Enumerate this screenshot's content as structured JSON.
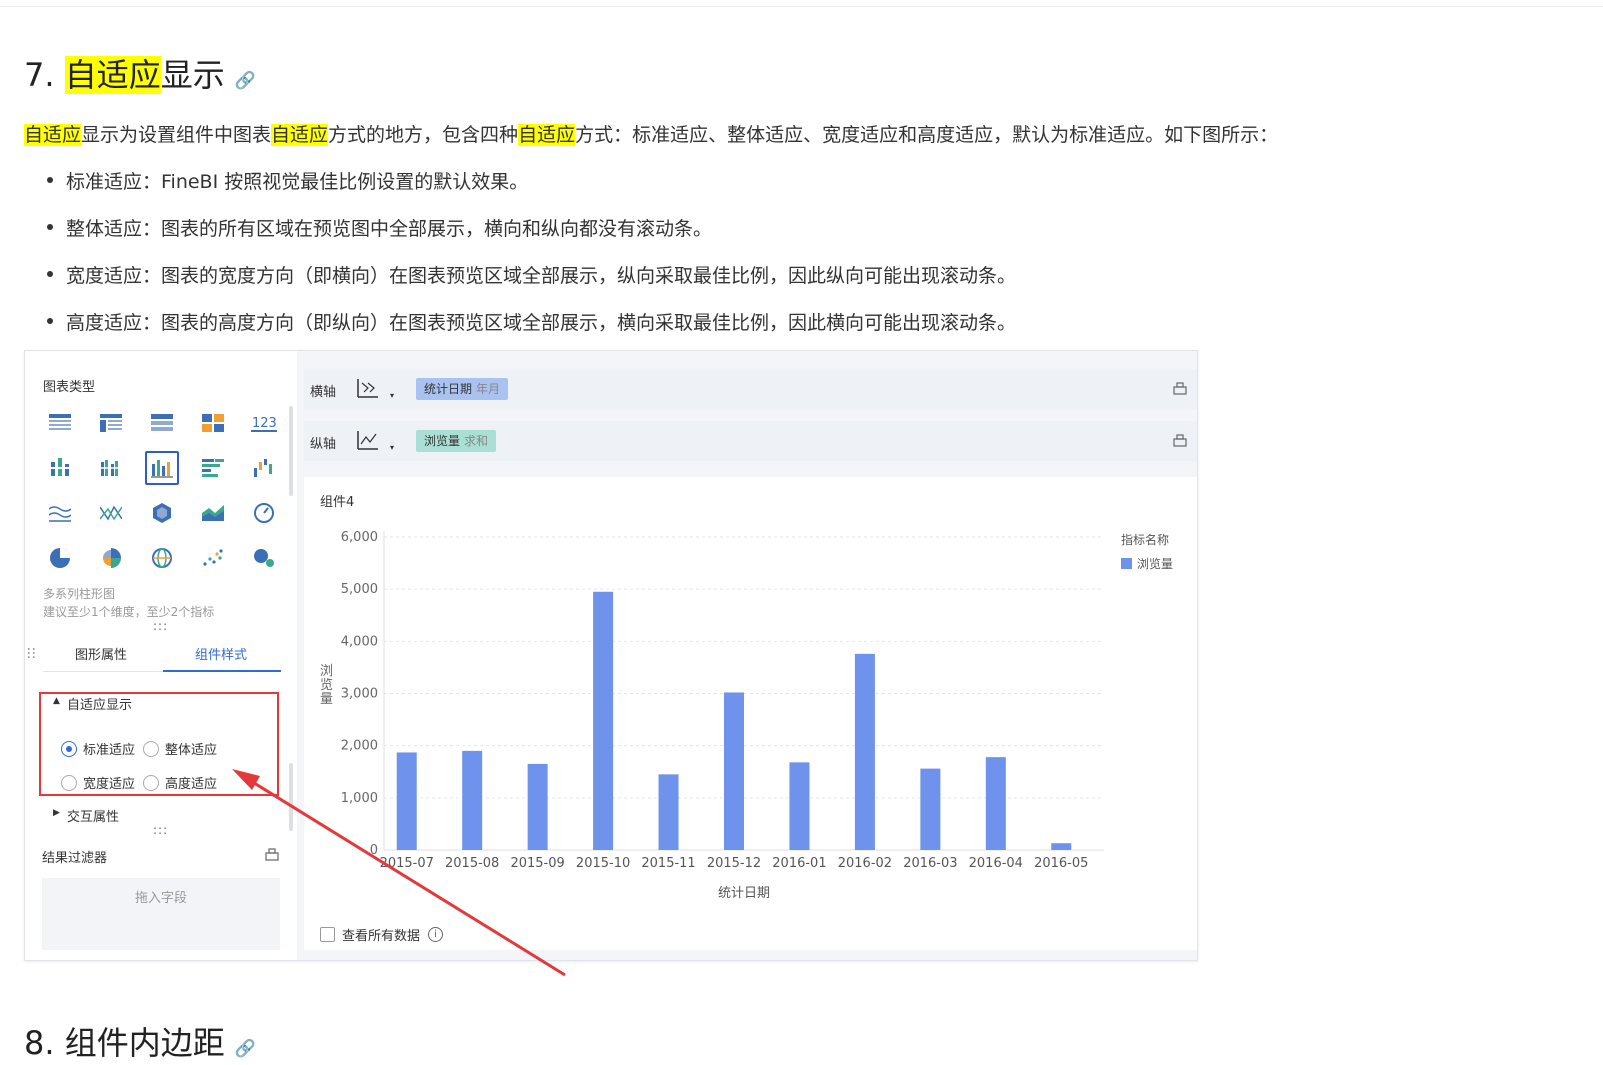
{
  "section7": {
    "number": "7. ",
    "highlight": "自适应",
    "rest": "显示",
    "link_icon": "link-icon"
  },
  "intro": {
    "p1": "自适应",
    "p2": "显示为设置组件中图表",
    "p3": "自适应",
    "p4": "方式的地方，包含四种",
    "p5": "自适应",
    "p6": "方式：标准适应、整体适应、宽度适应和高度适应，默认为标准适应。如下图所示："
  },
  "bullets": [
    "标准适应：FineBI 按照视觉最佳比例设置的默认效果。",
    "整体适应：图表的所有区域在预览图中全部展示，横向和纵向都没有滚动条。",
    "宽度适应：图表的宽度方向（即横向）在图表预览区域全部展示，纵向采取最佳比例，因此纵向可能出现滚动条。",
    "高度适应：图表的高度方向（即纵向）在图表预览区域全部展示，横向采取最佳比例，因此横向可能出现滚动条。"
  ],
  "panel": {
    "chart_type_label": "图表类型",
    "chart_desc_1": "多系列柱形图",
    "chart_desc_2": "建议至少1个维度，至少2个指标",
    "grip": ":::",
    "tab_graph": "图形属性",
    "tab_style": "组件样式",
    "adaptive_section": "自适应显示",
    "expanded_arrow": "▲",
    "collapsed_arrow": "▶",
    "radio_standard": "标准适应",
    "radio_whole": "整体适应",
    "radio_width": "宽度适应",
    "radio_height": "高度适应",
    "selected_radio": "标准适应",
    "interaction_section": "交互属性",
    "result_filter": "结果过滤器",
    "drop_field": "拖入字段"
  },
  "axes": {
    "x_label": "横轴",
    "y_label": "纵轴",
    "x_pill": "统计日期",
    "x_pill_sub": "年月",
    "y_pill": "浏览量",
    "y_pill_sub": "求和",
    "caret": "▾"
  },
  "chart_area": {
    "component_name": "组件4",
    "view_all": "查看所有数据",
    "info": "i"
  },
  "chart_data": {
    "type": "bar",
    "categories": [
      "2015-07",
      "2015-08",
      "2015-09",
      "2015-10",
      "2015-11",
      "2015-12",
      "2016-01",
      "2016-02",
      "2016-03",
      "2016-04",
      "2016-05"
    ],
    "series": [
      {
        "name": "浏览量",
        "values": [
          1870,
          1900,
          1650,
          4950,
          1450,
          3020,
          1680,
          3760,
          1560,
          1780,
          130
        ]
      }
    ],
    "xlabel": "统计日期",
    "ylabel": "浏览量",
    "ylim": [
      0,
      6000
    ],
    "yticks": [
      "0",
      "1,000",
      "2,000",
      "3,000",
      "4,000",
      "5,000",
      "6,000"
    ],
    "yticks_values": [
      0,
      1000,
      2000,
      3000,
      4000,
      5000,
      6000
    ],
    "legend_title": "指标名称",
    "legend_placement": "top-right",
    "grid": true,
    "bar_color": "#6f92ec"
  },
  "section8": {
    "title": "8. 组件内边距"
  },
  "colors": {
    "highlight": "#ffff00",
    "accent": "#2f6bd8",
    "annotation": "#e5383b"
  }
}
